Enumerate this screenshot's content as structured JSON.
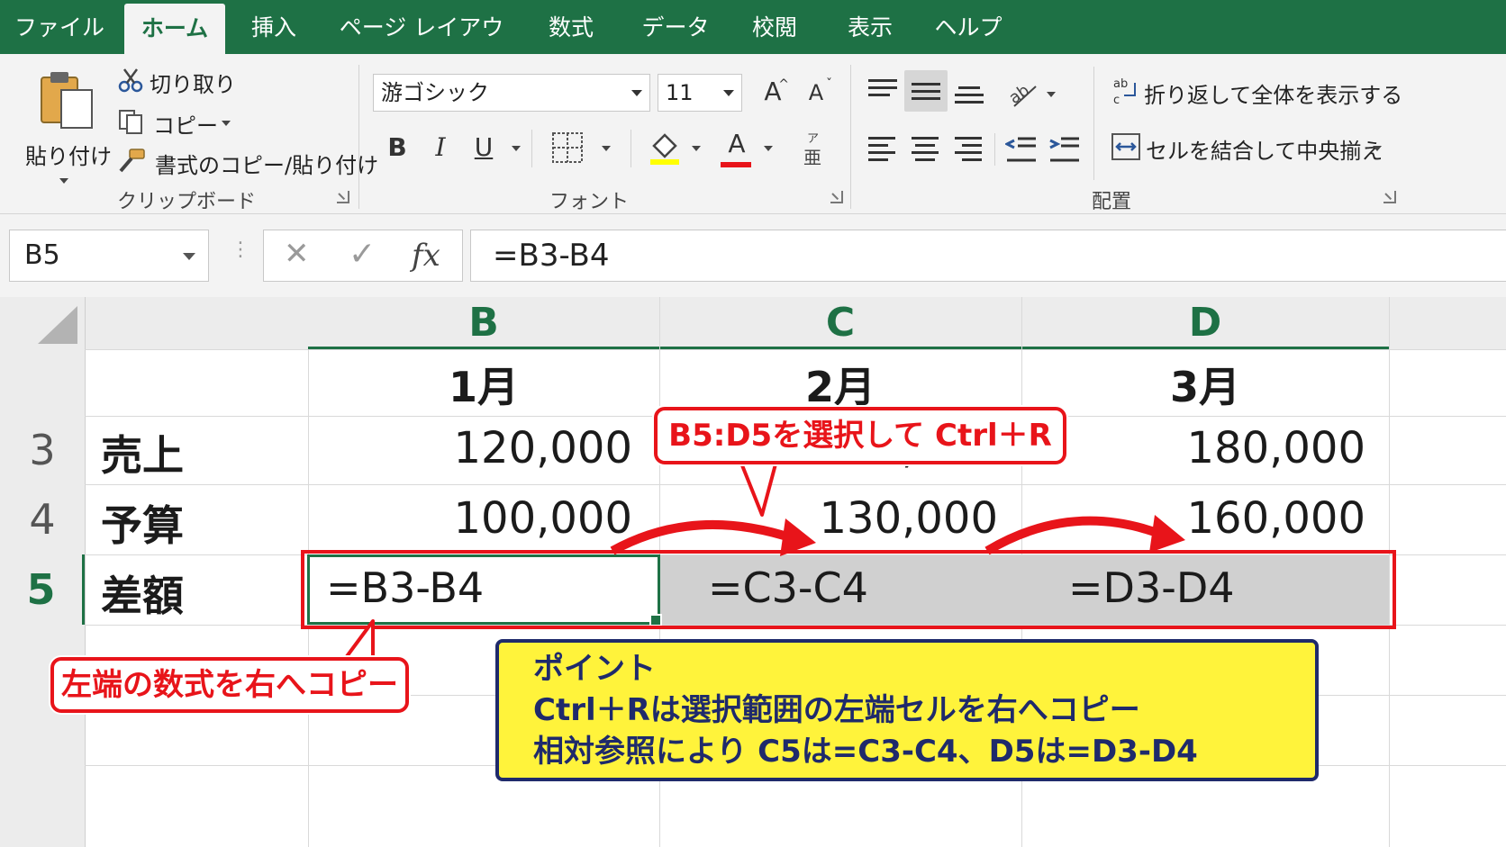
{
  "tabs": [
    "ファイル",
    "ホーム",
    "挿入",
    "ページ レイアウト",
    "数式",
    "データ",
    "校閲",
    "表示",
    "ヘルプ"
  ],
  "clipboard": {
    "paste": "貼り付け",
    "cut": "切り取り",
    "copy": "コピー",
    "format_painter": "書式のコピー/貼り付け",
    "group_label": "クリップボード"
  },
  "font": {
    "name": "游ゴシック",
    "size": "11",
    "bold": "B",
    "italic": "I",
    "underline": "U",
    "grow": "A",
    "shrink": "A",
    "font_color": "A",
    "group_label": "フォント",
    "accent_colors": {
      "highlight": "#ffff00",
      "font": "#e8141a"
    }
  },
  "alignment": {
    "wrap_text": "折り返して全体を表示する",
    "merge_center": "セルを結合して中央揃え",
    "group_label": "配置"
  },
  "formula_bar": {
    "name_box": "B5",
    "cancel": "✕",
    "enter": "✓",
    "fx": "fx",
    "formula": "=B3-B4"
  },
  "grid": {
    "columns": [
      "B",
      "C",
      "D"
    ],
    "rows": [
      {
        "num": "",
        "label": "",
        "values": [
          "1月",
          "2月",
          "3月"
        ]
      },
      {
        "num": "3",
        "label": "売上",
        "values": [
          "120,000",
          "150,000",
          "180,000"
        ]
      },
      {
        "num": "4",
        "label": "予算",
        "values": [
          "100,000",
          "130,000",
          "160,000"
        ]
      },
      {
        "num": "5",
        "label": "差額",
        "values": [
          "=B3-B4",
          "=C3-C4",
          "=D3-D4"
        ]
      }
    ]
  },
  "annotations": {
    "select_callout": "B5:D5を選択して Ctrl＋R",
    "left_callout": "左端の数式を右へコピー",
    "point_title": "ポイント",
    "point_line1": "Ctrl＋Rは選択範囲の左端セルを右へコピー",
    "point_line2": "相対参照により C5は=C3-C4、D5は=D3-D4"
  },
  "colors": {
    "excel_green": "#1e7145",
    "highlight_red": "#e8141a",
    "point_yellow": "#fff33b",
    "point_navy": "#1f2a6b"
  }
}
